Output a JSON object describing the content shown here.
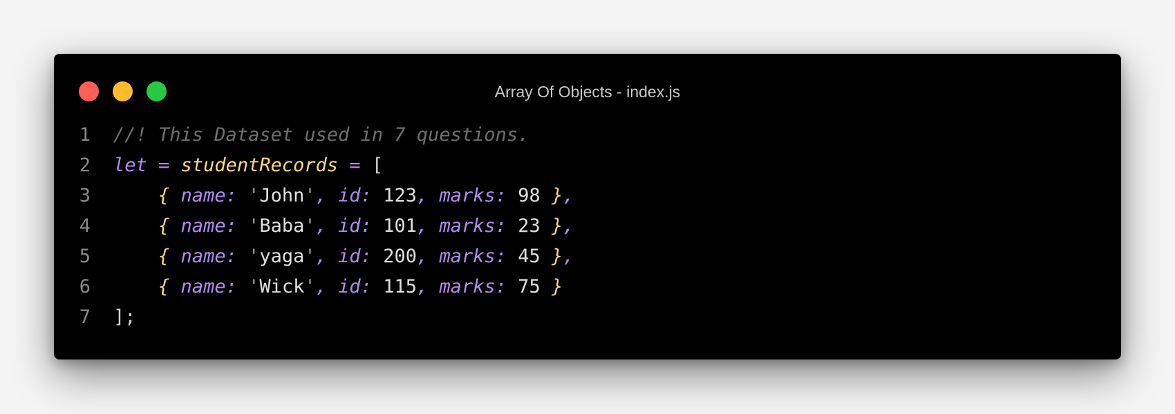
{
  "window": {
    "title": "Array Of Objects - index.js",
    "traffic_lights": [
      {
        "name": "close",
        "color": "#ff5f57"
      },
      {
        "name": "minimize",
        "color": "#febc2e"
      },
      {
        "name": "maximize",
        "color": "#28c840"
      }
    ]
  },
  "colors": {
    "background": "#f4f4f4",
    "editor_background": "#000000",
    "comment": "#6f6f6f",
    "keyword": "#b28cf1",
    "identifier": "#ffd97a",
    "plain": "#d4d4d4"
  },
  "code": {
    "lines": [
      {
        "number": "1",
        "tokens": [
          {
            "t": "//! This Dataset used in 7 questions.",
            "c": "comment"
          }
        ]
      },
      {
        "number": "2",
        "tokens": [
          {
            "t": "let",
            "c": "keyword"
          },
          {
            "t": " ",
            "c": "plain"
          },
          {
            "t": "=",
            "c": "op"
          },
          {
            "t": " ",
            "c": "plain"
          },
          {
            "t": "studentRecords",
            "c": "ident"
          },
          {
            "t": " ",
            "c": "plain"
          },
          {
            "t": "=",
            "c": "op"
          },
          {
            "t": " [",
            "c": "plain"
          }
        ]
      },
      {
        "number": "3",
        "tokens": [
          {
            "t": "    ",
            "c": "plain"
          },
          {
            "t": "{",
            "c": "brace"
          },
          {
            "t": " name:",
            "c": "prop"
          },
          {
            "t": " '",
            "c": "quote"
          },
          {
            "t": "John",
            "c": "string"
          },
          {
            "t": "'",
            "c": "quote"
          },
          {
            "t": ",",
            "c": "punct"
          },
          {
            "t": " id:",
            "c": "prop"
          },
          {
            "t": " 123",
            "c": "number"
          },
          {
            "t": ",",
            "c": "punct"
          },
          {
            "t": " marks:",
            "c": "prop"
          },
          {
            "t": " 98 ",
            "c": "number"
          },
          {
            "t": "}",
            "c": "brace"
          },
          {
            "t": ",",
            "c": "punct"
          }
        ]
      },
      {
        "number": "4",
        "tokens": [
          {
            "t": "    ",
            "c": "plain"
          },
          {
            "t": "{",
            "c": "brace"
          },
          {
            "t": " name:",
            "c": "prop"
          },
          {
            "t": " '",
            "c": "quote"
          },
          {
            "t": "Baba",
            "c": "string"
          },
          {
            "t": "'",
            "c": "quote"
          },
          {
            "t": ",",
            "c": "punct"
          },
          {
            "t": " id:",
            "c": "prop"
          },
          {
            "t": " 101",
            "c": "number"
          },
          {
            "t": ",",
            "c": "punct"
          },
          {
            "t": " marks:",
            "c": "prop"
          },
          {
            "t": " 23 ",
            "c": "number"
          },
          {
            "t": "}",
            "c": "brace"
          },
          {
            "t": ",",
            "c": "punct"
          }
        ]
      },
      {
        "number": "5",
        "tokens": [
          {
            "t": "    ",
            "c": "plain"
          },
          {
            "t": "{",
            "c": "brace"
          },
          {
            "t": " name:",
            "c": "prop"
          },
          {
            "t": " '",
            "c": "quote"
          },
          {
            "t": "yaga",
            "c": "string"
          },
          {
            "t": "'",
            "c": "quote"
          },
          {
            "t": ",",
            "c": "punct"
          },
          {
            "t": " id:",
            "c": "prop"
          },
          {
            "t": " 200",
            "c": "number"
          },
          {
            "t": ",",
            "c": "punct"
          },
          {
            "t": " marks:",
            "c": "prop"
          },
          {
            "t": " 45 ",
            "c": "number"
          },
          {
            "t": "}",
            "c": "brace"
          },
          {
            "t": ",",
            "c": "punct"
          }
        ]
      },
      {
        "number": "6",
        "tokens": [
          {
            "t": "    ",
            "c": "plain"
          },
          {
            "t": "{",
            "c": "brace"
          },
          {
            "t": " name:",
            "c": "prop"
          },
          {
            "t": " '",
            "c": "quote"
          },
          {
            "t": "Wick",
            "c": "string"
          },
          {
            "t": "'",
            "c": "quote"
          },
          {
            "t": ",",
            "c": "punct"
          },
          {
            "t": " id:",
            "c": "prop"
          },
          {
            "t": " 115",
            "c": "number"
          },
          {
            "t": ",",
            "c": "punct"
          },
          {
            "t": " marks:",
            "c": "prop"
          },
          {
            "t": " 75 ",
            "c": "number"
          },
          {
            "t": "}",
            "c": "brace"
          }
        ]
      },
      {
        "number": "7",
        "tokens": [
          {
            "t": "];",
            "c": "plain"
          }
        ]
      }
    ]
  }
}
